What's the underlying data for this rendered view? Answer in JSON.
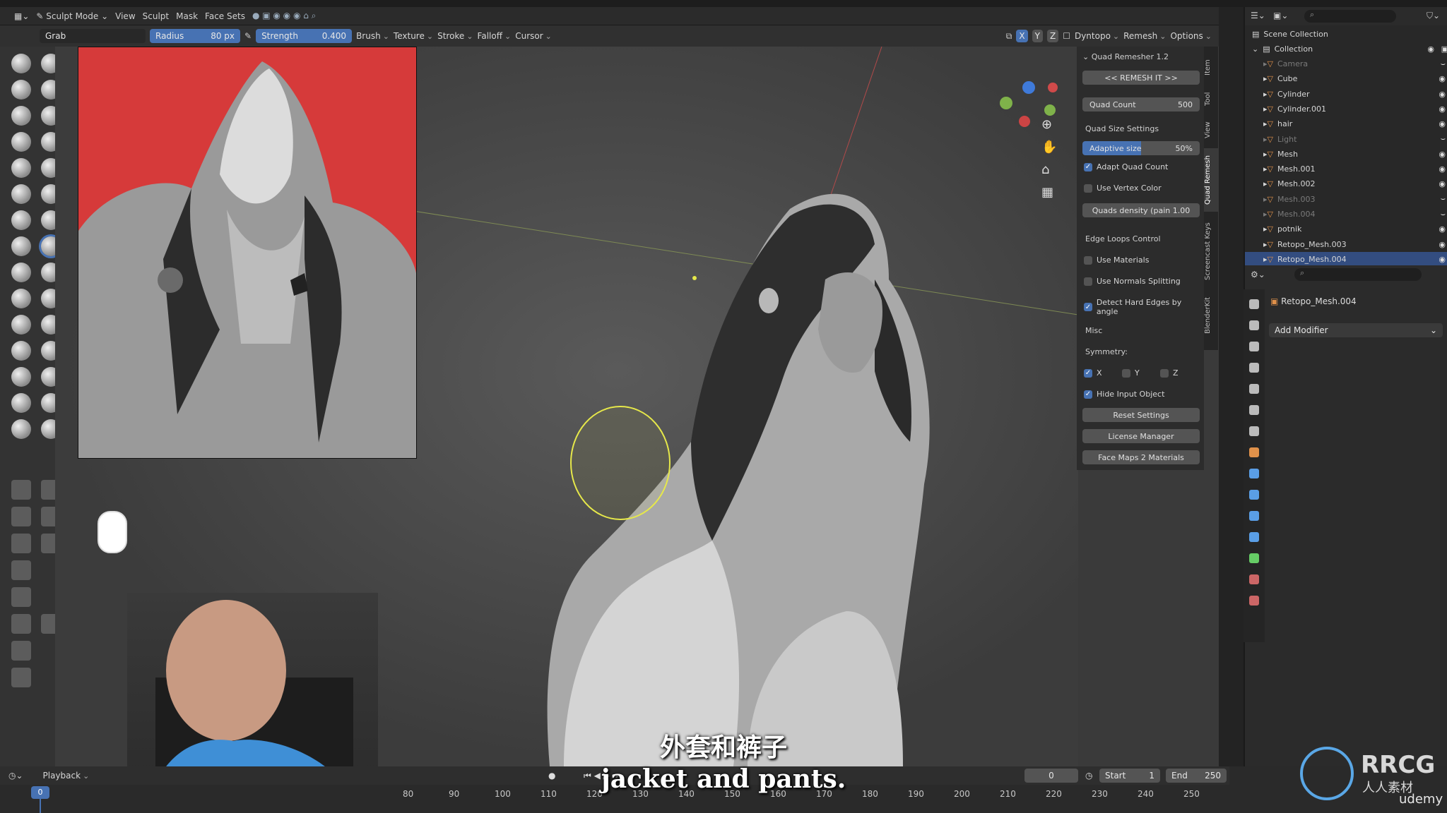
{
  "mode": {
    "label": "Sculpt Mode"
  },
  "menu": [
    "View",
    "Sculpt",
    "Mask",
    "Face Sets"
  ],
  "toolbar": {
    "tool": "Grab",
    "radius_label": "Radius",
    "radius_value": "80 px",
    "strength_label": "Strength",
    "strength_value": "0.400",
    "dropdowns": [
      "Brush",
      "Texture",
      "Stroke",
      "Falloff",
      "Cursor"
    ],
    "axes": [
      "X",
      "Y",
      "Z"
    ],
    "right": [
      "Dyntopo",
      "Remesh",
      "Options"
    ]
  },
  "quad_remesher": {
    "title": "Quad Remesher 1.2",
    "remesh_button": "<< REMESH IT >>",
    "quad_count_label": "Quad Count",
    "quad_count_value": "500",
    "quad_size_settings": "Quad Size Settings",
    "adaptive_size_label": "Adaptive size",
    "adaptive_size_value": "50%",
    "adaptive_size_fraction": 0.5,
    "adapt_quad_count": "Adapt Quad Count",
    "use_vertex_color": "Use Vertex Color",
    "quads_density": "Quads density (pain 1.00",
    "edge_loops_control": "Edge Loops Control",
    "use_materials": "Use Materials",
    "use_normals_splitting": "Use Normals Splitting",
    "detect_hard_edges": "Detect Hard Edges by angle",
    "misc": "Misc",
    "symmetry_label": "Symmetry:",
    "sym_x": "X",
    "sym_y": "Y",
    "sym_z": "Z",
    "hide_input_object": "Hide Input Object",
    "reset_settings": "Reset Settings",
    "license_manager": "License Manager",
    "face_maps": "Face Maps 2 Materials"
  },
  "side_tabs": [
    "Item",
    "Tool",
    "View",
    "Quad Remesh",
    "Screencast Keys",
    "BlenderKit"
  ],
  "outliner": {
    "scene_collection": "Scene Collection",
    "collection": "Collection",
    "items": [
      {
        "name": "Camera",
        "dim": true
      },
      {
        "name": "Cube",
        "dim": false
      },
      {
        "name": "Cylinder",
        "dim": false
      },
      {
        "name": "Cylinder.001",
        "dim": false
      },
      {
        "name": "hair",
        "dim": false
      },
      {
        "name": "Light",
        "dim": true
      },
      {
        "name": "Mesh",
        "dim": false
      },
      {
        "name": "Mesh.001",
        "dim": false
      },
      {
        "name": "Mesh.002",
        "dim": false
      },
      {
        "name": "Mesh.003",
        "dim": true
      },
      {
        "name": "Mesh.004",
        "dim": true
      },
      {
        "name": "potnik",
        "dim": false
      },
      {
        "name": "Retopo_Mesh.003",
        "dim": false
      },
      {
        "name": "Retopo_Mesh.004",
        "dim": false,
        "selected": true
      }
    ]
  },
  "properties": {
    "object_name": "Retopo_Mesh.004",
    "add_modifier": "Add Modifier"
  },
  "timeline": {
    "playback": "Playback",
    "current_frame": "0",
    "start_label": "Start",
    "start_value": "1",
    "end_label": "End",
    "end_value": "250",
    "ticks": [
      "80",
      "90",
      "100",
      "110",
      "120",
      "130",
      "140",
      "150",
      "160",
      "170",
      "180",
      "190",
      "200",
      "210",
      "220",
      "230",
      "240",
      "250"
    ],
    "frame_indicator": "0"
  },
  "subtitles": {
    "zh": "外套和裤子",
    "en": "jacket and pants."
  },
  "watermark": {
    "brand": "RRCG",
    "sub": "人人素材",
    "site": "udemy"
  },
  "colors": {
    "accent": "#4772b3",
    "brush_ring": "#e6e84a",
    "reference_bg": "#d63a3a"
  }
}
